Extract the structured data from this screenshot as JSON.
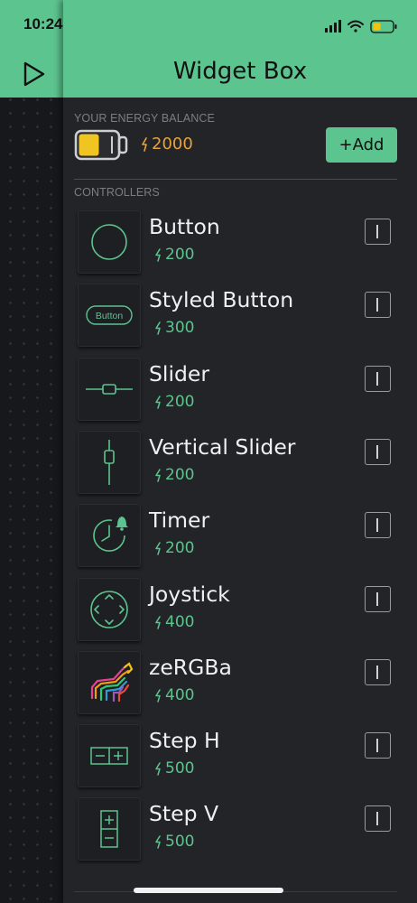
{
  "status_bar": {
    "time": "10:24",
    "icons": [
      "location-arrow-icon",
      "signal-icon",
      "wifi-icon",
      "battery-icon"
    ]
  },
  "header": {
    "title": "Widget Box",
    "play_icon": "play-icon"
  },
  "energy": {
    "section_label": "YOUR ENERGY BALANCE",
    "balance": "2000",
    "add_label": "+Add"
  },
  "controllers": {
    "section_label": "CONTROLLERS",
    "items": [
      {
        "name": "Button",
        "cost": "200",
        "icon": "button-circle-icon"
      },
      {
        "name": "Styled Button",
        "cost": "300",
        "icon": "styled-button-icon",
        "icon_text": "Button"
      },
      {
        "name": "Slider",
        "cost": "200",
        "icon": "slider-icon"
      },
      {
        "name": "Vertical Slider",
        "cost": "200",
        "icon": "vertical-slider-icon"
      },
      {
        "name": "Timer",
        "cost": "200",
        "icon": "timer-icon"
      },
      {
        "name": "Joystick",
        "cost": "400",
        "icon": "joystick-icon"
      },
      {
        "name": "zeRGBa",
        "cost": "400",
        "icon": "zebra-icon"
      },
      {
        "name": "Step H",
        "cost": "500",
        "icon": "step-h-icon"
      },
      {
        "name": "Step V",
        "cost": "500",
        "icon": "step-v-icon"
      }
    ]
  },
  "colors": {
    "accent": "#5cc48e",
    "background": "#232428",
    "energy": "#e8a23a"
  }
}
